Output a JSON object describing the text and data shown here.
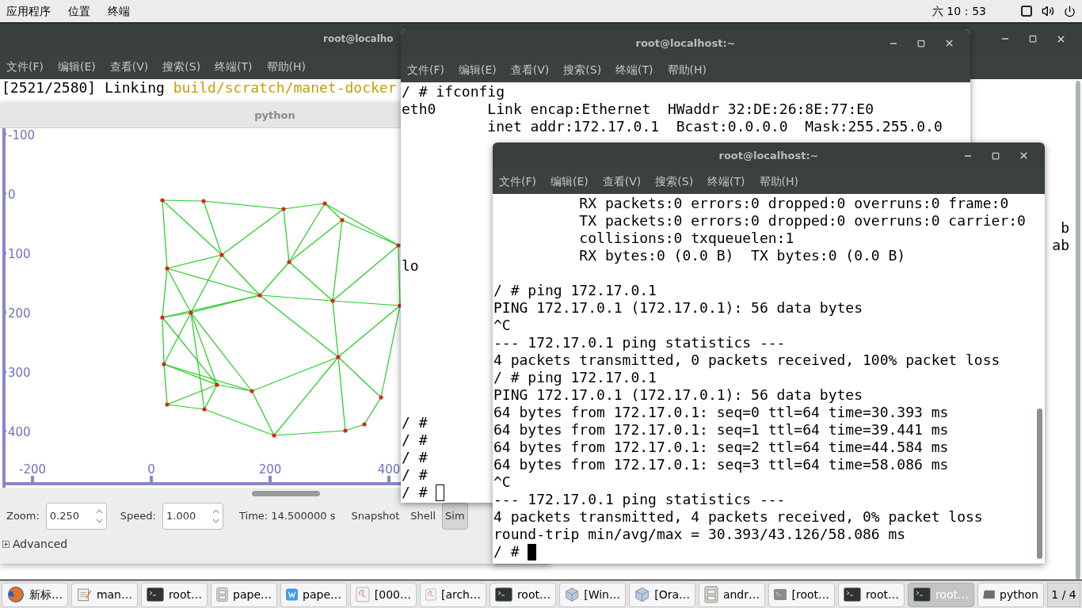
{
  "top_bar": {
    "menus": [
      "应用程序",
      "位置",
      "终端"
    ],
    "clock": "六 10：53"
  },
  "background_terminal": {
    "title": "root@localho",
    "menu": [
      "文件(F)",
      "编辑(E)",
      "查看(V)",
      "搜索(S)",
      "终端(T)",
      "帮助(H)"
    ],
    "lines": [
      {
        "segments": [
          {
            "text": "[2521/2580] Linking ",
            "kind": "plain"
          },
          {
            "text": "build/scratch/manet-docker",
            "kind": "path"
          }
        ]
      }
    ],
    "fragments": [
      "b",
      "ab"
    ]
  },
  "python_window": {
    "title": "python",
    "y_ticks": [
      "-100",
      "0",
      "100",
      "200",
      "300",
      "400"
    ],
    "x_ticks": [
      "-200",
      "0",
      "200",
      "400"
    ],
    "controls": {
      "zoom_label": "Zoom:",
      "zoom_value": "0.250",
      "speed_label": "Speed:",
      "speed_value": "1.000",
      "time": "Time: 14.500000 s",
      "buttons": [
        {
          "label": "Snapshot",
          "selected": false
        },
        {
          "label": "Shell",
          "selected": false
        },
        {
          "label": "Sim",
          "selected": true
        }
      ],
      "advanced": {
        "label": "Advanced",
        "expanded": false
      }
    }
  },
  "middle_terminal": {
    "title": "root@localhost:~",
    "focused": false,
    "menu": [
      "文件(F)",
      "编辑(E)",
      "查看(V)",
      "搜索(S)",
      "终端(T)",
      "帮助(H)"
    ],
    "lines": [
      {
        "kind": "line",
        "text": "/ # ifconfig"
      },
      {
        "kind": "line",
        "text": "eth0      Link encap:Ethernet  HWaddr 32:DE:26:8E:77:E0"
      },
      {
        "kind": "line",
        "text": "          inet addr:172.17.0.1  Bcast:0.0.0.0  Mask:255.255.0.0"
      },
      {
        "kind": "blank"
      },
      {
        "kind": "blank"
      },
      {
        "kind": "blank"
      },
      {
        "kind": "blank"
      },
      {
        "kind": "blank"
      },
      {
        "kind": "blank"
      },
      {
        "kind": "blank"
      },
      {
        "kind": "line",
        "text": "lo"
      },
      {
        "kind": "blank"
      },
      {
        "kind": "blank"
      },
      {
        "kind": "blank"
      },
      {
        "kind": "blank"
      },
      {
        "kind": "blank"
      },
      {
        "kind": "blank"
      },
      {
        "kind": "blank"
      },
      {
        "kind": "blank"
      },
      {
        "kind": "line",
        "text": "/ #"
      },
      {
        "kind": "line",
        "text": "/ #"
      },
      {
        "kind": "line",
        "text": "/ #"
      },
      {
        "kind": "line",
        "text": "/ #"
      },
      {
        "kind": "prompt",
        "text": "/ # "
      }
    ]
  },
  "front_terminal": {
    "title": "root@localhost:~",
    "focused": true,
    "menu": [
      "文件(F)",
      "编辑(E)",
      "查看(V)",
      "搜索(S)",
      "终端(T)",
      "帮助(H)"
    ],
    "lines": [
      {
        "kind": "line",
        "text": "          RX packets:0 errors:0 dropped:0 overruns:0 frame:0"
      },
      {
        "kind": "line",
        "text": "          TX packets:0 errors:0 dropped:0 overruns:0 carrier:0"
      },
      {
        "kind": "line",
        "text": "          collisions:0 txqueuelen:1"
      },
      {
        "kind": "line",
        "text": "          RX bytes:0 (0.0 B)  TX bytes:0 (0.0 B)"
      },
      {
        "kind": "blank"
      },
      {
        "kind": "line",
        "text": "/ # ping 172.17.0.1"
      },
      {
        "kind": "line",
        "text": "PING 172.17.0.1 (172.17.0.1): 56 data bytes"
      },
      {
        "kind": "line",
        "text": "^C"
      },
      {
        "kind": "line",
        "text": "--- 172.17.0.1 ping statistics ---"
      },
      {
        "kind": "line",
        "text": "4 packets transmitted, 0 packets received, 100% packet loss"
      },
      {
        "kind": "line",
        "text": "/ # ping 172.17.0.1"
      },
      {
        "kind": "line",
        "text": "PING 172.17.0.1 (172.17.0.1): 56 data bytes"
      },
      {
        "kind": "line",
        "text": "64 bytes from 172.17.0.1: seq=0 ttl=64 time=30.393 ms"
      },
      {
        "kind": "line",
        "text": "64 bytes from 172.17.0.1: seq=1 ttl=64 time=39.441 ms"
      },
      {
        "kind": "line",
        "text": "64 bytes from 172.17.0.1: seq=2 ttl=64 time=44.584 ms"
      },
      {
        "kind": "line",
        "text": "64 bytes from 172.17.0.1: seq=3 ttl=64 time=58.086 ms"
      },
      {
        "kind": "line",
        "text": "^C"
      },
      {
        "kind": "line",
        "text": "--- 172.17.0.1 ping statistics ---"
      },
      {
        "kind": "line",
        "text": "4 packets transmitted, 4 packets received, 0% packet loss"
      },
      {
        "kind": "line",
        "text": "round-trip min/avg/max = 30.393/43.126/58.086 ms"
      },
      {
        "kind": "prompt",
        "text": "/ # "
      }
    ]
  },
  "taskbar": {
    "items": [
      {
        "label": "新标…",
        "kind": "browser",
        "selected": false
      },
      {
        "label": "man…",
        "kind": "editor",
        "selected": false
      },
      {
        "label": "root…",
        "kind": "terminal",
        "selected": false
      },
      {
        "label": "pape…",
        "kind": "cabinet",
        "selected": false
      },
      {
        "label": "pape…",
        "kind": "writer",
        "selected": false
      },
      {
        "label": "[000…",
        "kind": "document",
        "selected": false
      },
      {
        "label": "[arch…",
        "kind": "document",
        "selected": false
      },
      {
        "label": "root…",
        "kind": "terminal",
        "selected": false
      },
      {
        "label": "[Win…",
        "kind": "box",
        "selected": false
      },
      {
        "label": "[Ora…",
        "kind": "box",
        "selected": false
      },
      {
        "label": "andr…",
        "kind": "cabinet",
        "selected": false
      },
      {
        "label": "[root…",
        "kind": "terminal-minimized",
        "selected": false
      },
      {
        "label": "root…",
        "kind": "terminal",
        "selected": false
      },
      {
        "label": "root…",
        "kind": "terminal",
        "selected": true
      },
      {
        "label": "python",
        "kind": "window",
        "selected": false
      }
    ],
    "workspace": "1 / 4"
  }
}
